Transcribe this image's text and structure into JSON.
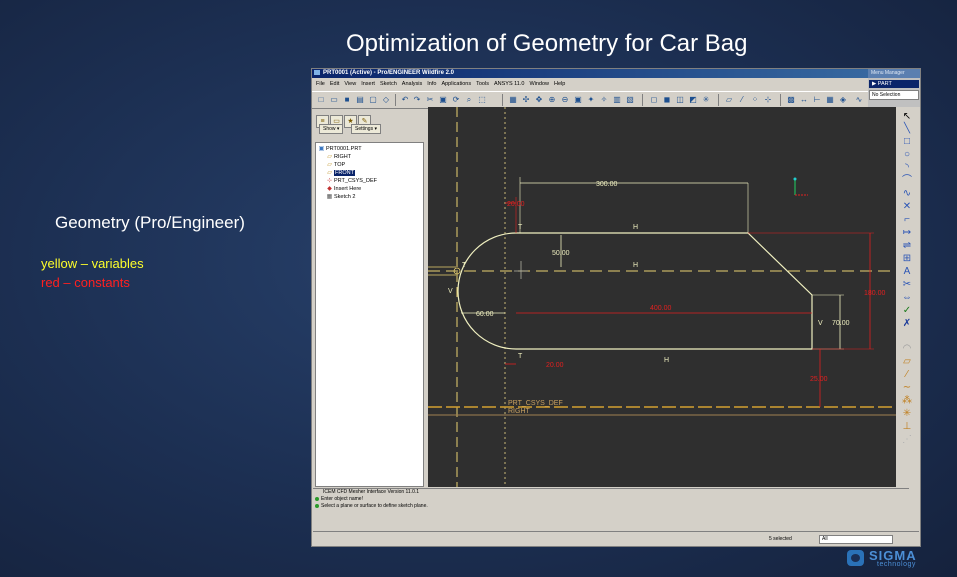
{
  "slide": {
    "title": "Optimization of  Geometry for Car Bag",
    "geometry_label": "Geometry (Pro/Engineer)",
    "legend_yellow": "yellow – variables",
    "legend_red": "red – constants"
  },
  "colors": {
    "variables": "#ffff2a",
    "constants": "#ff2020",
    "canvas": "#2f2f2f"
  },
  "window": {
    "title": "PRT0001 (Active) - Pro/ENGINEER Wildfire 2.0",
    "menus": [
      "File",
      "Edit",
      "View",
      "Insert",
      "Sketch",
      "Analysis",
      "Info",
      "Applications",
      "Tools",
      "ANSYS 11.0",
      "Window",
      "Help"
    ]
  },
  "menu_manager": {
    "title": "Menu Manager",
    "item": "▶ PART",
    "selection": "No Selection"
  },
  "left_panel": {
    "show_label": "Show ▾",
    "settings_label": "Settings ▾",
    "tree": [
      {
        "icon": "part-icon",
        "label": "PRT0001.PRT",
        "selected": false
      },
      {
        "icon": "datum-plane-icon",
        "label": "RIGHT",
        "selected": false
      },
      {
        "icon": "datum-plane-icon",
        "label": "TOP",
        "selected": false
      },
      {
        "icon": "datum-plane-icon",
        "label": "FRONT",
        "selected": true
      },
      {
        "icon": "csys-icon",
        "label": "PRT_CSYS_DEF",
        "selected": false
      },
      {
        "icon": "insert-here-icon",
        "label": "Insert Here",
        "selected": false
      },
      {
        "icon": "sketch-icon",
        "label": "Sketch 2",
        "selected": false
      }
    ]
  },
  "sketch": {
    "dims_yellow": [
      "300.00",
      "50.00",
      "60.00",
      "70.00"
    ],
    "dims_red": [
      "20.00",
      "400.00",
      "180.00",
      "20.00",
      "25.00"
    ],
    "constraints": [
      "T",
      "H",
      "T",
      "H",
      "T",
      "H",
      "V",
      "V"
    ],
    "datum_labels": [
      "PRT_CSYS_DEF",
      "RIGHT"
    ]
  },
  "messages": [
    "ICEM CFD Mesher Interface Version 11.0.1",
    "Enter object name!",
    "Select a plane or surface to define sketch plane."
  ],
  "status": {
    "selected": "5 selected",
    "filter": "All"
  },
  "logo": {
    "name": "SIGMA",
    "sub": "technology"
  }
}
